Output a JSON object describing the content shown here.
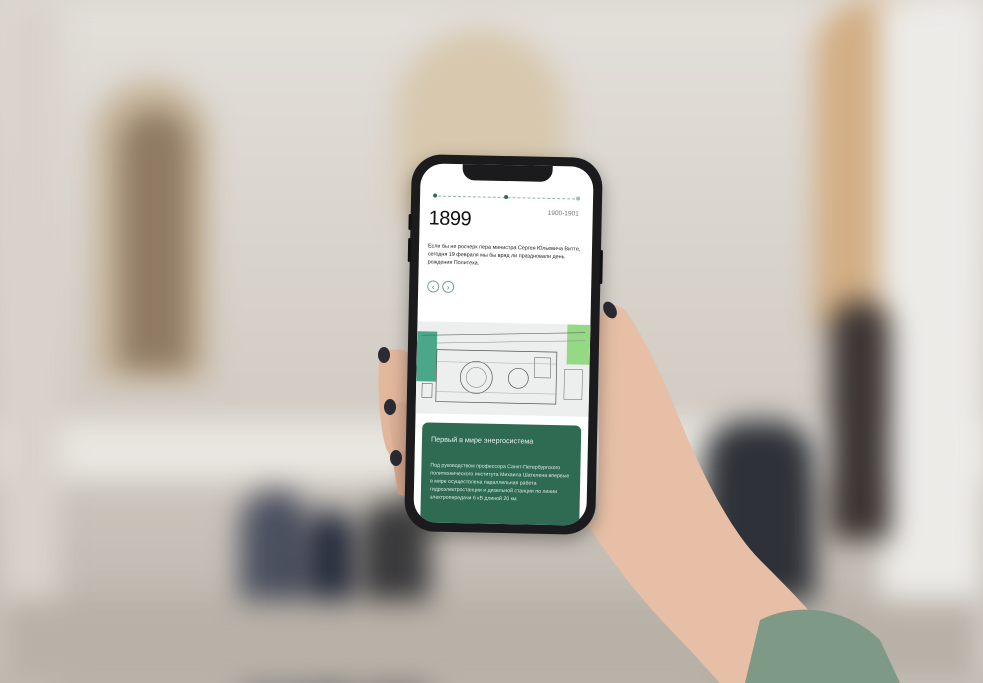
{
  "timeline": {
    "year": "1899",
    "next_year": "1900-1901",
    "intro_text": "Если бы не росчерк пера министра Сергея Юльевича Витте, сегодня 19 февраля мы бы вряд ли праздновали день рождения Политеха."
  },
  "nav": {
    "prev_icon": "‹",
    "next_icon": "›"
  },
  "card": {
    "title": "Первый в мире энергосистема",
    "body": "Под руководством профессора Санкт-Петербургского политехнического института Михаила Шателена впервые в мире осуществлена параллельная работа гидроэлектростанции и дизельной станции по линии электропередачи 6 кВ длиной 20 км."
  },
  "colors": {
    "accent_green": "#2f6a53",
    "card_text": "#e8f2ed"
  },
  "icons": [
    "chevron-left-icon",
    "chevron-right-icon"
  ]
}
